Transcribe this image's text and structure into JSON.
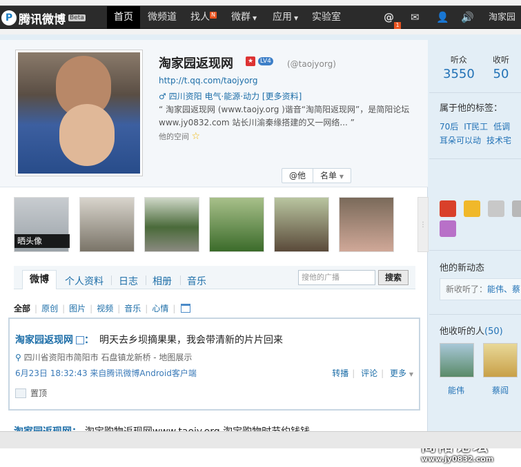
{
  "nav": {
    "logo_text": "腾讯微博",
    "beta": "Beta",
    "items": [
      {
        "label": "首页",
        "active": true
      },
      {
        "label": "微频道"
      },
      {
        "label": "找人",
        "badge": "N"
      },
      {
        "label": "微群"
      },
      {
        "label": "应用"
      },
      {
        "label": "实验室"
      }
    ],
    "at_badge": "1",
    "user": "淘家园"
  },
  "profile": {
    "name": "淘家园返现网",
    "level": "LV4",
    "handle": "(@taojyorg)",
    "url": "http://t.qq.com/taojyorg",
    "location": "四川资阳",
    "tags_line": "电气·能源·动力",
    "more_info": "[更多资料]",
    "desc": "“ 淘家园返现网 (www.taojy.org )谐音“淘简阳返现网”，是简阳论坛www.jy0832.com 站长川渝秦缘搭建的又一网络... ”",
    "space": "他的空间",
    "at_btn": "@他",
    "list_btn": "名单"
  },
  "photos": {
    "caption": "晒头像"
  },
  "tabs": {
    "items": [
      "微博",
      "个人资料",
      "日志",
      "相册",
      "音乐"
    ],
    "search_placeholder": "搜他的广播",
    "search_btn": "搜索"
  },
  "filters": [
    "全部",
    "原创",
    "图片",
    "视频",
    "音乐",
    "心情"
  ],
  "post": {
    "author": "淘家园返现网",
    "colon": "：",
    "text": "明天去乡坝摘果果，我会带清新的片片回来",
    "location": "四川省资阳市简阳市 石盘镇龙新桥 - 地图展示",
    "meta": "6月23日 18:32:43 来自腾讯微博Android客户端",
    "actions": [
      "转播",
      "评论",
      "更多"
    ],
    "pin_label": "置顶"
  },
  "post2": {
    "author": "淘家园返现网：",
    "text": "淘宝购物返现网www.taojy.org 淘宝购物时节约钱钱"
  },
  "sidebar": {
    "fans_label": "听众",
    "fans_count": "3550",
    "follow_label": "收听",
    "follow_count": "50",
    "tags_title": "属于他的标签：",
    "tags": [
      "70后",
      "IT民工",
      "低调",
      "耳朵可以动",
      "技术宅"
    ],
    "news_title": "他的新动态",
    "news_text": "新收听了：",
    "news_names": "能伟、蔡",
    "following_title": "他收听的人",
    "following_count": "(50)",
    "following": [
      "能伟",
      "蔡阎"
    ]
  },
  "watermark": {
    "title": "简阳论坛",
    "url": "www.jy0832.com"
  }
}
